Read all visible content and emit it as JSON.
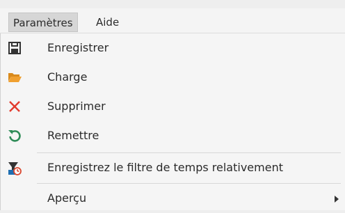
{
  "menubar": {
    "items": [
      {
        "label": "Paramètres",
        "active": true
      },
      {
        "label": "Aide",
        "active": false
      }
    ]
  },
  "menu": {
    "items": [
      {
        "label": "Enregistrer",
        "icon": "save-icon"
      },
      {
        "label": "Charge",
        "icon": "folder-open-icon"
      },
      {
        "label": "Supprimer",
        "icon": "delete-x-icon"
      },
      {
        "label": "Remettre",
        "icon": "reset-icon"
      },
      {
        "label": "Enregistrez le filtre de temps relativement",
        "icon": "save-time-filter-icon"
      },
      {
        "label": "Aperçu",
        "icon": "",
        "has_submenu": true
      }
    ]
  },
  "colors": {
    "delete_red": "#e23b2e",
    "reset_green": "#2e8b57",
    "folder_orange": "#f0a030",
    "icon_dark": "#333333",
    "clock_red": "#d9462e"
  }
}
